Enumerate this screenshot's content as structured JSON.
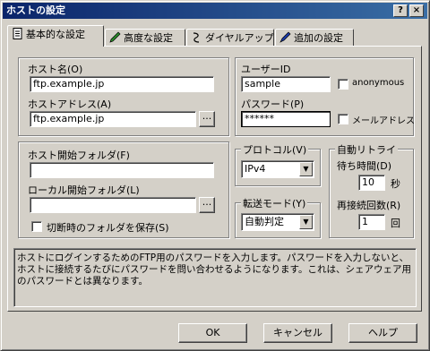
{
  "window": {
    "title": "ホストの設定",
    "help_glyph": "?",
    "close_glyph": "×"
  },
  "tabs": [
    {
      "label": "基本的な設定",
      "icon": "document-icon"
    },
    {
      "label": "高度な設定",
      "icon": "pencil-check-icon"
    },
    {
      "label": "ダイヤルアップ",
      "icon": "phone-cord-icon"
    },
    {
      "label": "追加の設定",
      "icon": "pen-icon"
    }
  ],
  "host": {
    "name_label": "ホスト名(O)",
    "name_value": "ftp.example.jp",
    "address_label": "ホストアドレス(A)",
    "address_value": "ftp.example.jp",
    "browse_label": "..."
  },
  "user": {
    "userid_label": "ユーザーID",
    "userid_value": "sample",
    "anonymous_label": "anonymous",
    "password_label": "パスワード(P)",
    "password_value": "******",
    "mailaddress_label": "メールアドレス"
  },
  "folders": {
    "host_folder_label": "ホスト開始フォルダ(F)",
    "host_folder_value": "",
    "local_folder_label": "ローカル開始フォルダ(L)",
    "local_folder_value": "",
    "browse_label": "...",
    "save_on_disconnect_label": "切断時のフォルダを保存(S)"
  },
  "protocol": {
    "group_label": "プロトコル(V)",
    "value": "IPv4"
  },
  "transfer": {
    "group_label": "転送モード(Y)",
    "value": "自動判定"
  },
  "retry": {
    "group_label": "自動リトライ",
    "wait_label": "待ち時間(D)",
    "wait_value": "10",
    "wait_unit": "秒",
    "count_label": "再接続回数(R)",
    "count_value": "1",
    "count_unit": "回"
  },
  "description": "ホストにログインするためのFTP用のパスワードを入力します。パスワードを入力しないと、ホストに接続するたびにパスワードを問い合わせるようになります。これは、シェアウェア用のパスワードとは異なります。",
  "buttons": {
    "ok": "OK",
    "cancel": "キャンセル",
    "help": "ヘルプ"
  }
}
